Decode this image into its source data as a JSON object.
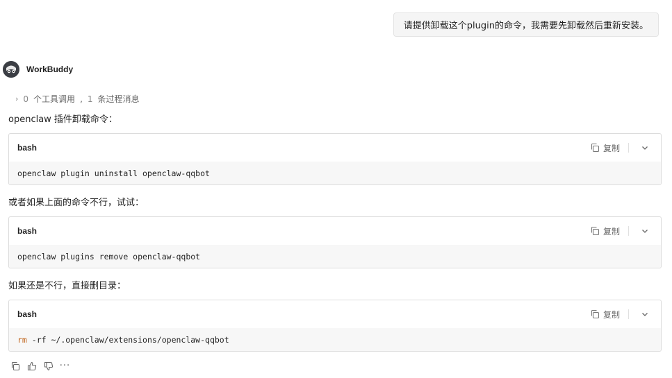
{
  "user_message": "请提供卸载这个plugin的命令，我需要先卸载然后重新安装。",
  "assistant": {
    "name": "WorkBuddy",
    "tool_summary": {
      "tool_count": "0",
      "tool_label": "个工具调用",
      "sep": ",",
      "msg_count": "1",
      "msg_label": "条过程消息"
    },
    "blocks": [
      {
        "intro": "openclaw 插件卸载命令：",
        "lang": "bash",
        "copy_label": "复制",
        "code": "openclaw plugin uninstall openclaw-qqbot"
      },
      {
        "intro": "或者如果上面的命令不行，试试：",
        "lang": "bash",
        "copy_label": "复制",
        "code": "openclaw plugins remove openclaw-qqbot"
      },
      {
        "intro": "如果还是不行，直接删目录：",
        "lang": "bash",
        "copy_label": "复制",
        "code_keyword": "rm",
        "code_rest": " -rf ~/.openclaw/extensions/openclaw-qqbot"
      }
    ],
    "footer_more": "···"
  },
  "colors": {
    "keyword": "#c0631a",
    "bubble_bg": "#f5f5f5",
    "code_bg": "#f7f7f7"
  }
}
